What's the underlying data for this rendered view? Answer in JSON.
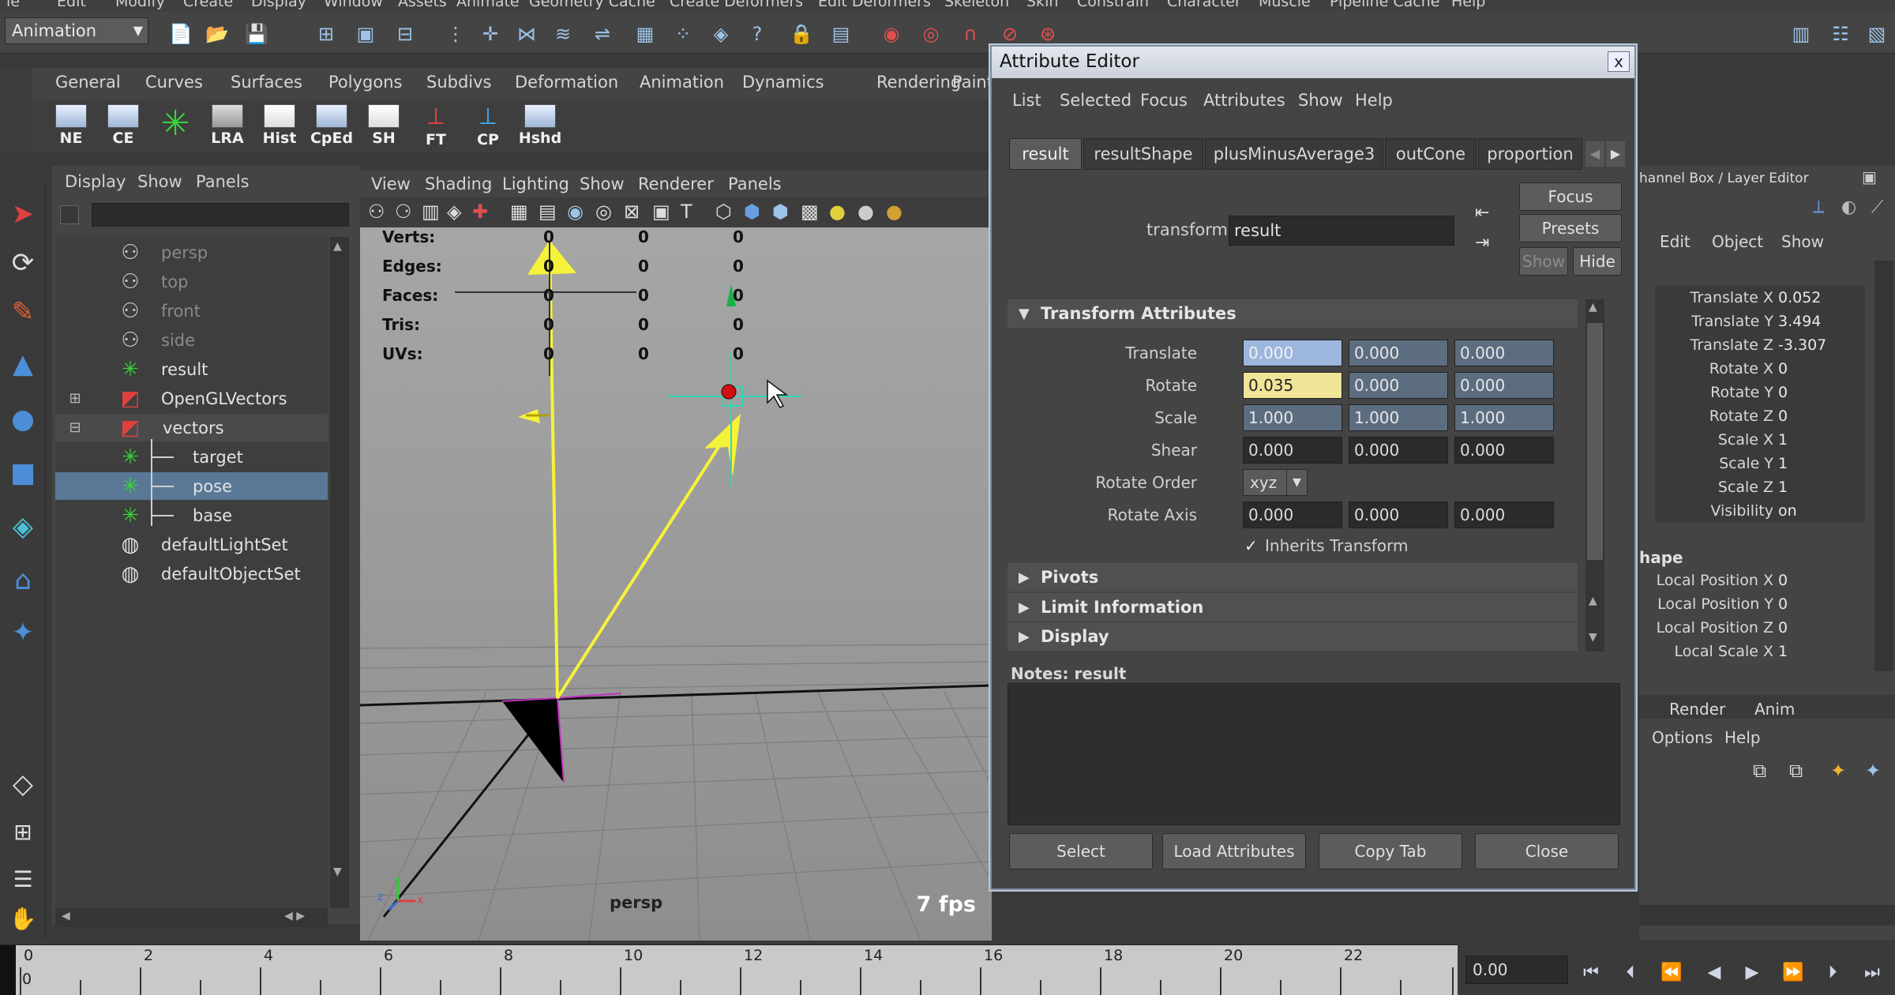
{
  "menubar": {
    "items": [
      "le",
      "Edit",
      "Modify",
      "Create",
      "Display",
      "Window",
      "Assets",
      "Animate",
      "Geometry Cache",
      "Create Deformers",
      "Edit Deformers",
      "Skeleton",
      "Skin",
      "Constrain",
      "Character",
      "Muscle",
      "Pipeline Cache",
      "Help"
    ]
  },
  "statusline": {
    "mode": "Animation"
  },
  "shelf": {
    "tabs": [
      "General",
      "Curves",
      "Surfaces",
      "Polygons",
      "Subdivs",
      "Deformation",
      "Animation",
      "Dynamics",
      "Rendering",
      "Paint"
    ],
    "buttons": [
      "NE",
      "CE",
      "",
      "LRA",
      "Hist",
      "CpEd",
      "SH",
      "FT",
      "CP",
      "Hshd"
    ]
  },
  "outliner": {
    "menu": [
      "Display",
      "Show",
      "Panels"
    ],
    "items": [
      {
        "label": "persp",
        "dim": true,
        "icon": "camera-icon"
      },
      {
        "label": "top",
        "dim": true,
        "icon": "camera-icon"
      },
      {
        "label": "front",
        "dim": true,
        "icon": "camera-icon"
      },
      {
        "label": "side",
        "dim": true,
        "icon": "camera-icon"
      },
      {
        "label": "result",
        "dim": false,
        "icon": "locator-icon"
      },
      {
        "label": "OpenGLVectors",
        "dim": false,
        "icon": "node-icon"
      },
      {
        "label": "vectors",
        "dim": false,
        "icon": "node-icon"
      },
      {
        "label": "target",
        "dim": false,
        "icon": "locator-icon"
      },
      {
        "label": "pose",
        "dim": false,
        "icon": "locator-icon"
      },
      {
        "label": "base",
        "dim": false,
        "icon": "locator-icon"
      },
      {
        "label": "defaultLightSet",
        "dim": false,
        "icon": "set-icon"
      },
      {
        "label": "defaultObjectSet",
        "dim": false,
        "icon": "set-icon"
      }
    ]
  },
  "viewport": {
    "menu": [
      "View",
      "Shading",
      "Lighting",
      "Show",
      "Renderer",
      "Panels"
    ],
    "hud": {
      "labels": [
        "Verts:",
        "Edges:",
        "Faces:",
        "Tris:",
        "UVs:"
      ],
      "values": [
        "0",
        "0",
        "0"
      ]
    },
    "camera": "persp",
    "fps": "7 fps"
  },
  "attributeEditor": {
    "title": "Attribute Editor",
    "close": "x",
    "menu": [
      "List",
      "Selected",
      "Focus",
      "Attributes",
      "Show",
      "Help"
    ],
    "tabs": [
      "result",
      "resultShape",
      "plusMinusAverage3",
      "outCone",
      "proportion"
    ],
    "side_buttons": {
      "focus": "Focus",
      "presets": "Presets",
      "show": "Show",
      "hide": "Hide"
    },
    "transform_label": "transform:",
    "transform_value": "result",
    "section": "Transform Attributes",
    "attrs": {
      "translate": {
        "label": "Translate",
        "values": [
          "0.000",
          "0.000",
          "0.000"
        ]
      },
      "rotate": {
        "label": "Rotate",
        "values": [
          "0.035",
          "0.000",
          "0.000"
        ]
      },
      "scale": {
        "label": "Scale",
        "values": [
          "1.000",
          "1.000",
          "1.000"
        ]
      },
      "shear": {
        "label": "Shear",
        "values": [
          "0.000",
          "0.000",
          "0.000"
        ]
      },
      "rotateOrder": {
        "label": "Rotate Order",
        "value": "xyz"
      },
      "rotateAxis": {
        "label": "Rotate Axis",
        "values": [
          "0.000",
          "0.000",
          "0.000"
        ]
      },
      "inherits": "Inherits Transform"
    },
    "collapsed": [
      "Pivots",
      "Limit Information",
      "Display"
    ],
    "notes_label": "Notes:  result",
    "bottom_buttons": [
      "Select",
      "Load Attributes",
      "Copy Tab",
      "Close"
    ]
  },
  "channelBox": {
    "title": "hannel Box / Layer Editor",
    "menu": [
      "Edit",
      "Object",
      "Show"
    ],
    "channels": [
      {
        "label": "Translate X",
        "value": "0.052"
      },
      {
        "label": "Translate Y",
        "value": "3.494"
      },
      {
        "label": "Translate Z",
        "value": "-3.307"
      },
      {
        "label": "Rotate X",
        "value": "0"
      },
      {
        "label": "Rotate Y",
        "value": "0"
      },
      {
        "label": "Rotate Z",
        "value": "0"
      },
      {
        "label": "Scale X",
        "value": "1"
      },
      {
        "label": "Scale Y",
        "value": "1"
      },
      {
        "label": "Scale Z",
        "value": "1"
      },
      {
        "label": "Visibility",
        "value": "on"
      }
    ],
    "shape_header": "hape",
    "shape_channels": [
      {
        "label": "Local Position X",
        "value": "0"
      },
      {
        "label": "Local Position Y",
        "value": "0"
      },
      {
        "label": "Local Position Z",
        "value": "0"
      },
      {
        "label": "Local Scale X",
        "value": "1"
      }
    ],
    "layer_tabs": [
      "Render",
      "Anim"
    ],
    "layer_menu": [
      "Options",
      "Help"
    ]
  },
  "timeSlider": {
    "ticks": [
      "0",
      "2",
      "4",
      "6",
      "8",
      "10",
      "12",
      "14",
      "16",
      "18",
      "20",
      "22"
    ],
    "bottom_left": "0",
    "current": "0.00"
  }
}
